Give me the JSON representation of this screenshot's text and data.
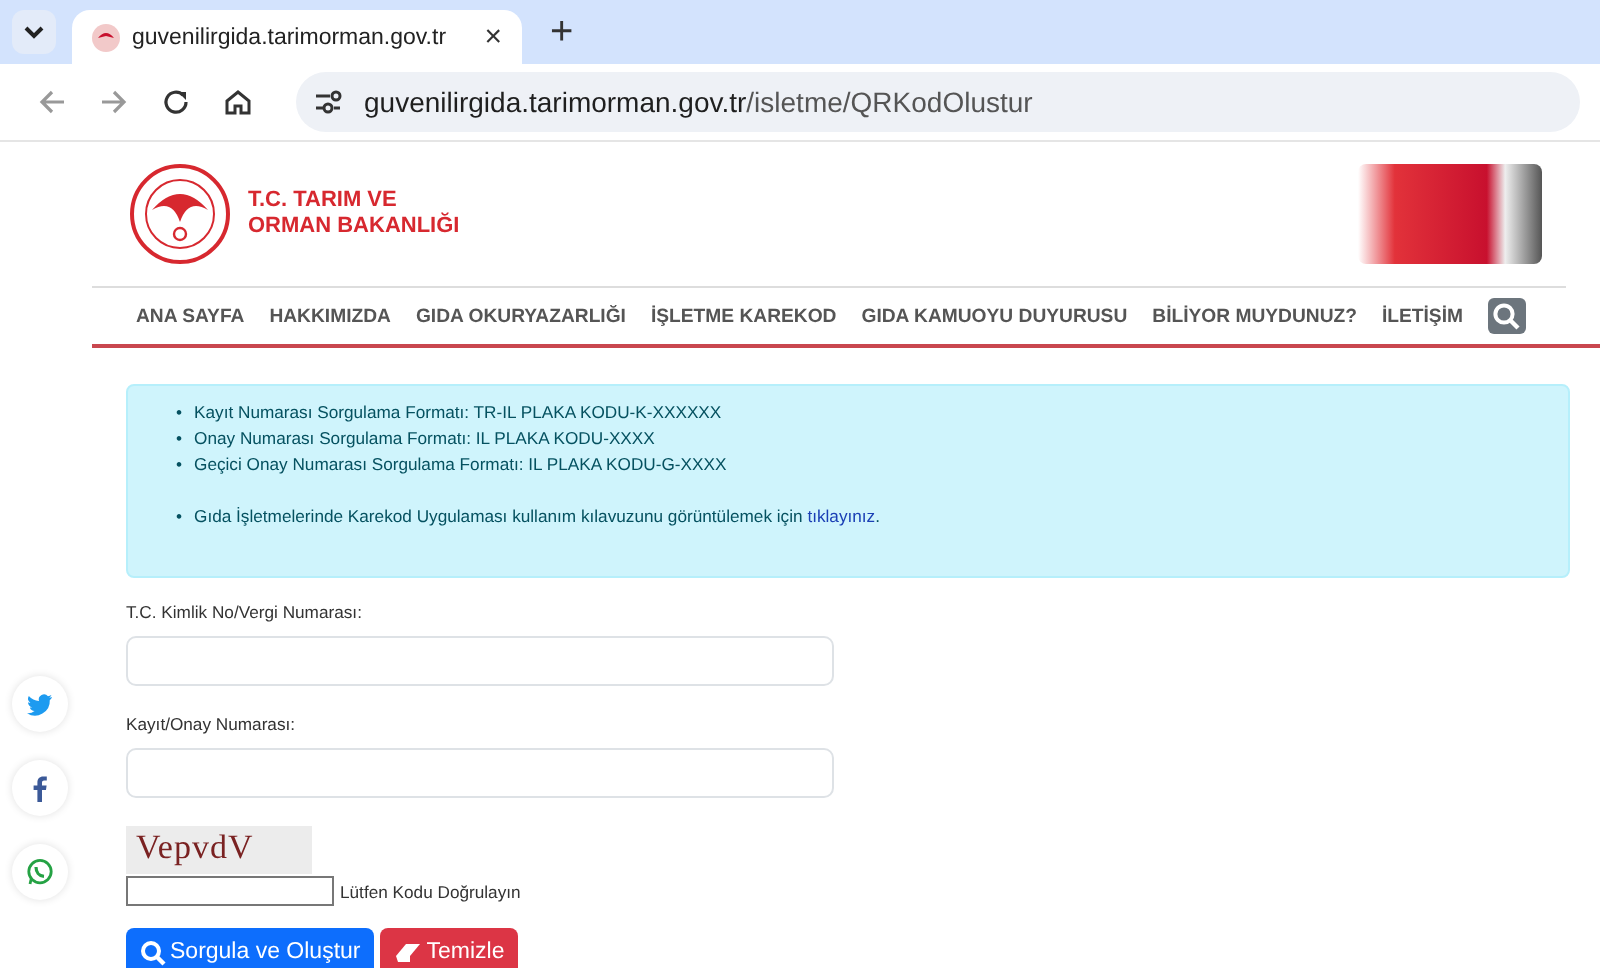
{
  "browser": {
    "tab": {
      "title": "guvenilirgida.tarimorman.gov.tr",
      "close": "×",
      "selected": true
    },
    "new_tab": "+",
    "url": {
      "host": "guvenilirgida.tarimorman.gov.tr",
      "path": "/isletme/QRKodOlustur"
    }
  },
  "header": {
    "logo_text": [
      "T.C. TARIM VE",
      "ORMAN BAKANLIĞI"
    ]
  },
  "nav": [
    {
      "label": "ANA SAYFA"
    },
    {
      "label": "HAKKIMIZDA"
    },
    {
      "label": "GIDA OKURYAZARLIĞI"
    },
    {
      "label": "İŞLETME KAREKOD"
    },
    {
      "label": "GIDA KAMUOYU DUYURUSU"
    },
    {
      "label": "BİLİYOR MUYDUNUZ?"
    },
    {
      "label": "İLETİŞİM"
    }
  ],
  "info": {
    "marker": "•",
    "items": [
      "Kayıt Numarası Sorgulama Formatı: TR-IL PLAKA KODU-K-XXXXXX",
      "Onay Numarası Sorgulama Formatı: IL PLAKA KODU-XXXX",
      "Geçici Onay Numarası Sorgulama Formatı: IL PLAKA KODU-G-XXXX"
    ],
    "guide": {
      "text": "Gıda İşletmelerinde Karekod Uygulaması kullanım kılavuzunu görüntülemek için",
      "link": "tıklayınız",
      "end": "."
    }
  },
  "form": {
    "fields": [
      {
        "label": "T.C. Kimlik No/Vergi Numarası:"
      },
      {
        "label": "Kayıt/Onay Numarası:"
      }
    ],
    "captcha": {
      "code": "VepvdV",
      "hint": "Lütfen Kodu Doğrulayın"
    },
    "buttons": [
      {
        "kind": "primary",
        "label": "Sorgula ve Oluştur"
      },
      {
        "kind": "danger",
        "label": "Temizle"
      }
    ]
  },
  "social": [
    {
      "kind": "twitter"
    },
    {
      "kind": "facebook"
    },
    {
      "kind": "whatsapp"
    }
  ]
}
